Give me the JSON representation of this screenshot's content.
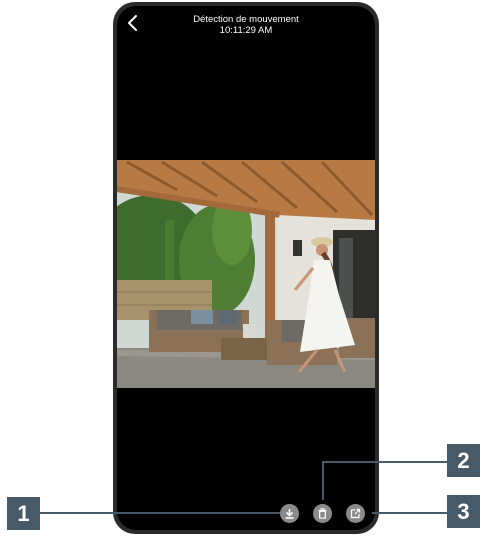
{
  "header": {
    "title": "Détection de mouvement",
    "time": "10:11:29 AM"
  },
  "icons": {
    "back": "chevron-left-icon",
    "download": "download-icon",
    "delete": "trash-icon",
    "share": "share-icon"
  },
  "callouts": {
    "one": "1",
    "two": "2",
    "three": "3"
  },
  "colors": {
    "callout": "#475a69",
    "button": "#8a8a8a",
    "screen": "#000000"
  }
}
